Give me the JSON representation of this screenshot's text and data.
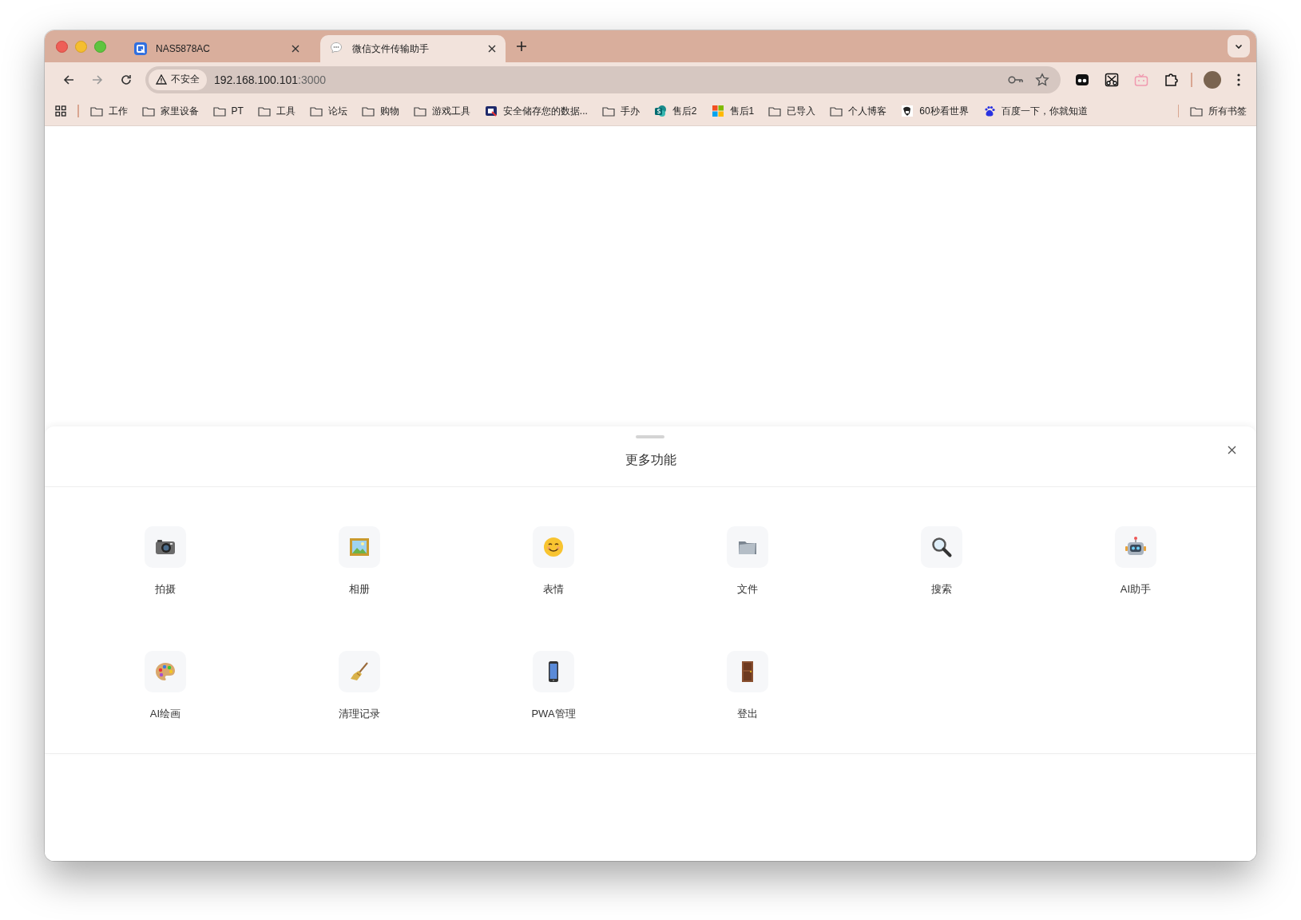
{
  "tabs": [
    {
      "title": "NAS5878AC",
      "selected": false
    },
    {
      "title": "微信文件传输助手",
      "selected": true
    }
  ],
  "address_bar": {
    "security_label": "不安全",
    "host": "192.168.100.101",
    "port": ":3000"
  },
  "bookmarks": [
    {
      "kind": "folder",
      "label": "工作"
    },
    {
      "kind": "folder",
      "label": "家里设备"
    },
    {
      "kind": "folder",
      "label": "PT"
    },
    {
      "kind": "folder",
      "label": "工具"
    },
    {
      "kind": "folder",
      "label": "论坛"
    },
    {
      "kind": "folder",
      "label": "购物"
    },
    {
      "kind": "folder",
      "label": "游戏工具"
    },
    {
      "kind": "site",
      "label": "安全储存您的数据..."
    },
    {
      "kind": "folder",
      "label": "手办"
    },
    {
      "kind": "site",
      "label": "售后2"
    },
    {
      "kind": "site",
      "label": "售后1"
    },
    {
      "kind": "folder",
      "label": "已导入"
    },
    {
      "kind": "folder",
      "label": "个人博客"
    },
    {
      "kind": "site",
      "label": "60秒看世界"
    },
    {
      "kind": "site",
      "label": "百度一下，你就知道"
    }
  ],
  "all_bookmarks": {
    "label": "所有书签"
  },
  "sheet": {
    "title": "更多功能",
    "items": [
      {
        "label": "拍摄"
      },
      {
        "label": "相册"
      },
      {
        "label": "表情"
      },
      {
        "label": "文件"
      },
      {
        "label": "搜索"
      },
      {
        "label": "AI助手"
      },
      {
        "label": "AI绘画"
      },
      {
        "label": "清理记录"
      },
      {
        "label": "PWA管理"
      },
      {
        "label": "登出"
      }
    ]
  }
}
